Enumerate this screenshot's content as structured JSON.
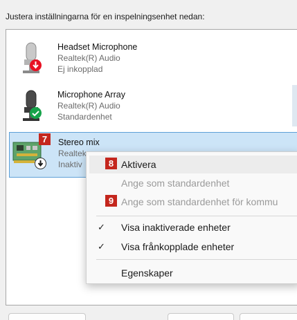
{
  "instruction": "Justera inställningarna för en inspelningsenhet nedan:",
  "devices": [
    {
      "name": "Headset Microphone",
      "driver": "Realtek(R) Audio",
      "status": "Ej inkopplad",
      "badge": "unplugged-down-arrow-icon",
      "badge_color": "#e81123"
    },
    {
      "name": "Microphone Array",
      "driver": "Realtek(R) Audio",
      "status": "Standardenhet",
      "badge": "default-check-icon",
      "badge_color": "#16a34a"
    },
    {
      "name": "Stereo mix",
      "driver": "Realtek",
      "status": "Inaktiv",
      "badge": "disabled-down-arrow-icon",
      "badge_color": "#1a1a1a"
    }
  ],
  "callouts": {
    "device": "7",
    "enable": "8",
    "set_default_comm": "9"
  },
  "context_menu": {
    "items": [
      {
        "label": "Aktivera",
        "state": "hover"
      },
      {
        "label": "Ange som standardenhet",
        "state": "disabled"
      },
      {
        "label": "Ange som standardenhet för kommu",
        "state": "disabled"
      },
      {
        "label": "Visa inaktiverade enheter",
        "checked": true
      },
      {
        "label": "Visa frånkopplade enheter",
        "checked": true
      },
      {
        "label": "Egenskaper"
      }
    ],
    "check_glyph": "✓"
  },
  "colors": {
    "selection": "#cce4f7",
    "selection_border": "#5c9fd6",
    "callout": "#c4261d"
  }
}
